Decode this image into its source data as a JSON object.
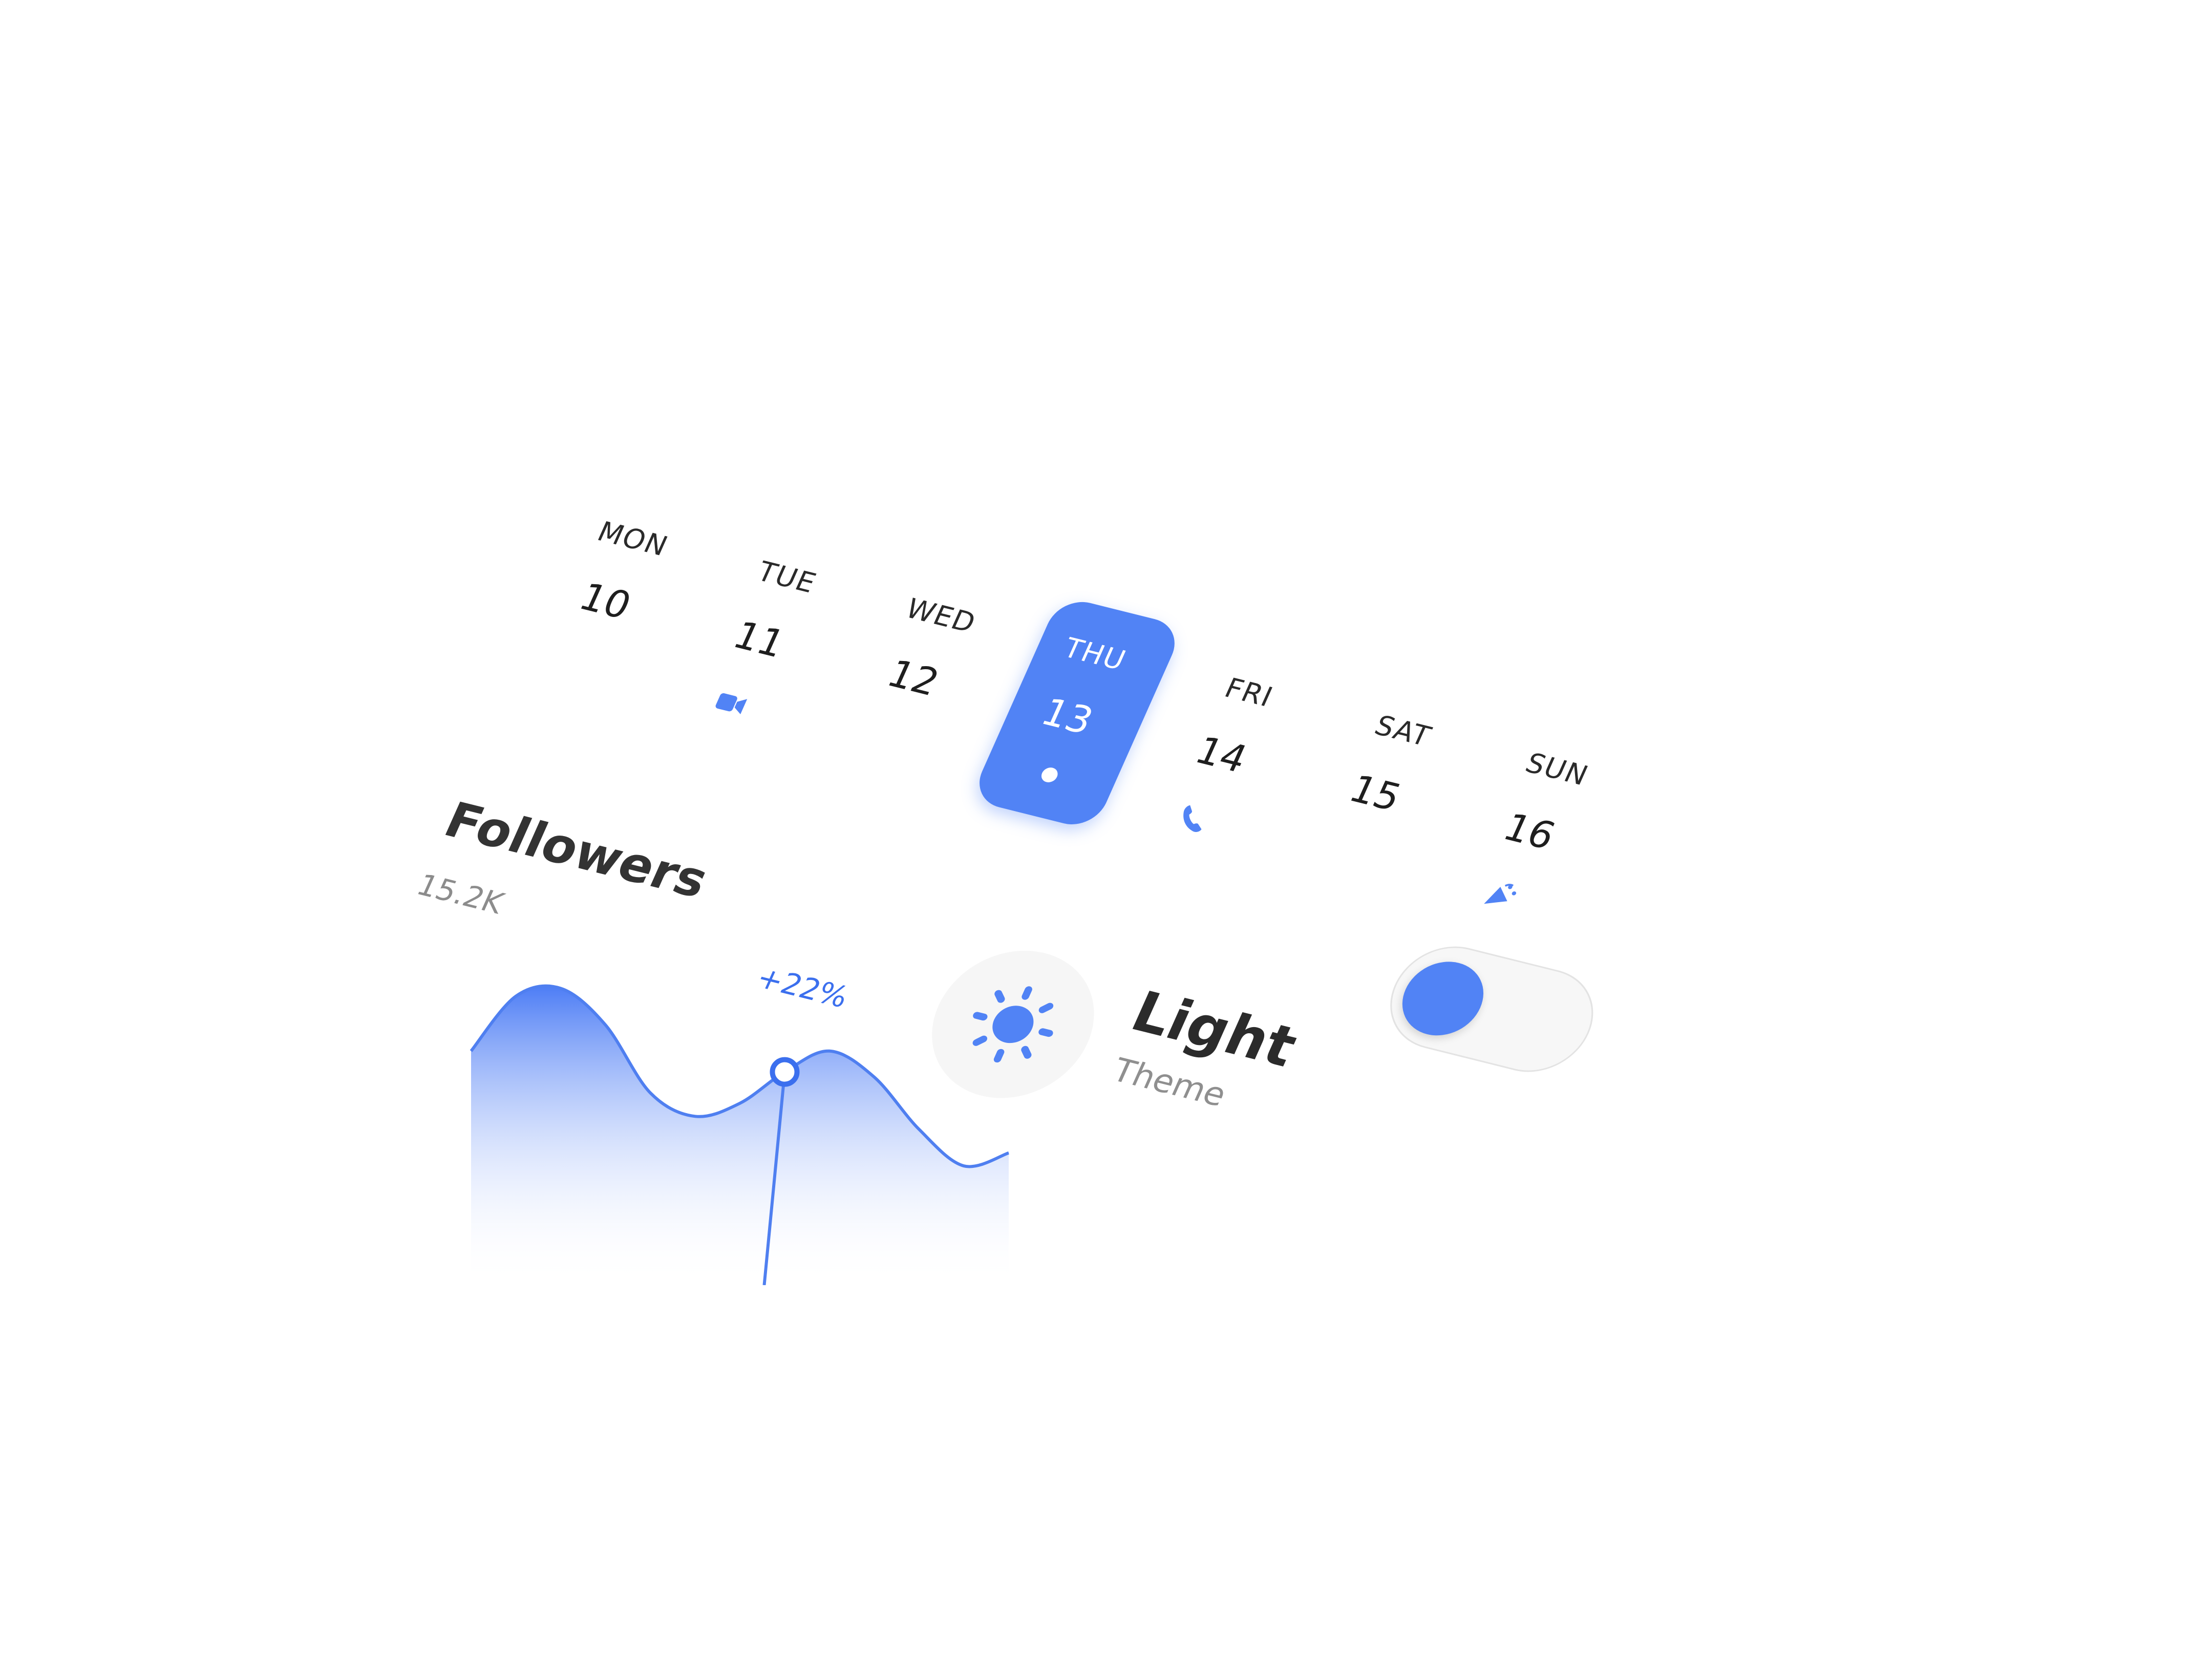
{
  "calendar": {
    "days": [
      {
        "name": "MON",
        "num": "10",
        "icon": ""
      },
      {
        "name": "TUE",
        "num": "11",
        "icon": "video-camera-icon"
      },
      {
        "name": "WED",
        "num": "12",
        "icon": ""
      },
      {
        "name": "THU",
        "num": "13",
        "icon": "",
        "active": true
      },
      {
        "name": "FRI",
        "num": "14",
        "icon": "phone-icon"
      },
      {
        "name": "SAT",
        "num": "15",
        "icon": ""
      },
      {
        "name": "SUN",
        "num": "16",
        "icon": "party-popper-icon"
      }
    ]
  },
  "followers": {
    "title": "Followers",
    "count": "15.2K",
    "change": "+22%"
  },
  "theme": {
    "title": "Light",
    "subtitle": "Theme",
    "icon": "sun-icon",
    "toggle_state": "on"
  },
  "colors": {
    "accent": "#5183f5",
    "accent_text": "#3b6fee",
    "muted": "#8c8c8c",
    "surface": "#f6f6f6"
  },
  "chart_data": {
    "type": "area",
    "x": [
      0,
      1,
      2,
      3,
      4,
      5,
      6,
      7,
      8,
      9,
      10,
      11,
      12
    ],
    "values": [
      0.72,
      0.93,
      0.96,
      0.82,
      0.56,
      0.47,
      0.52,
      0.64,
      0.72,
      0.62,
      0.42,
      0.28,
      0.33
    ],
    "highlight_index": 7,
    "grid": false,
    "legend": "none"
  }
}
